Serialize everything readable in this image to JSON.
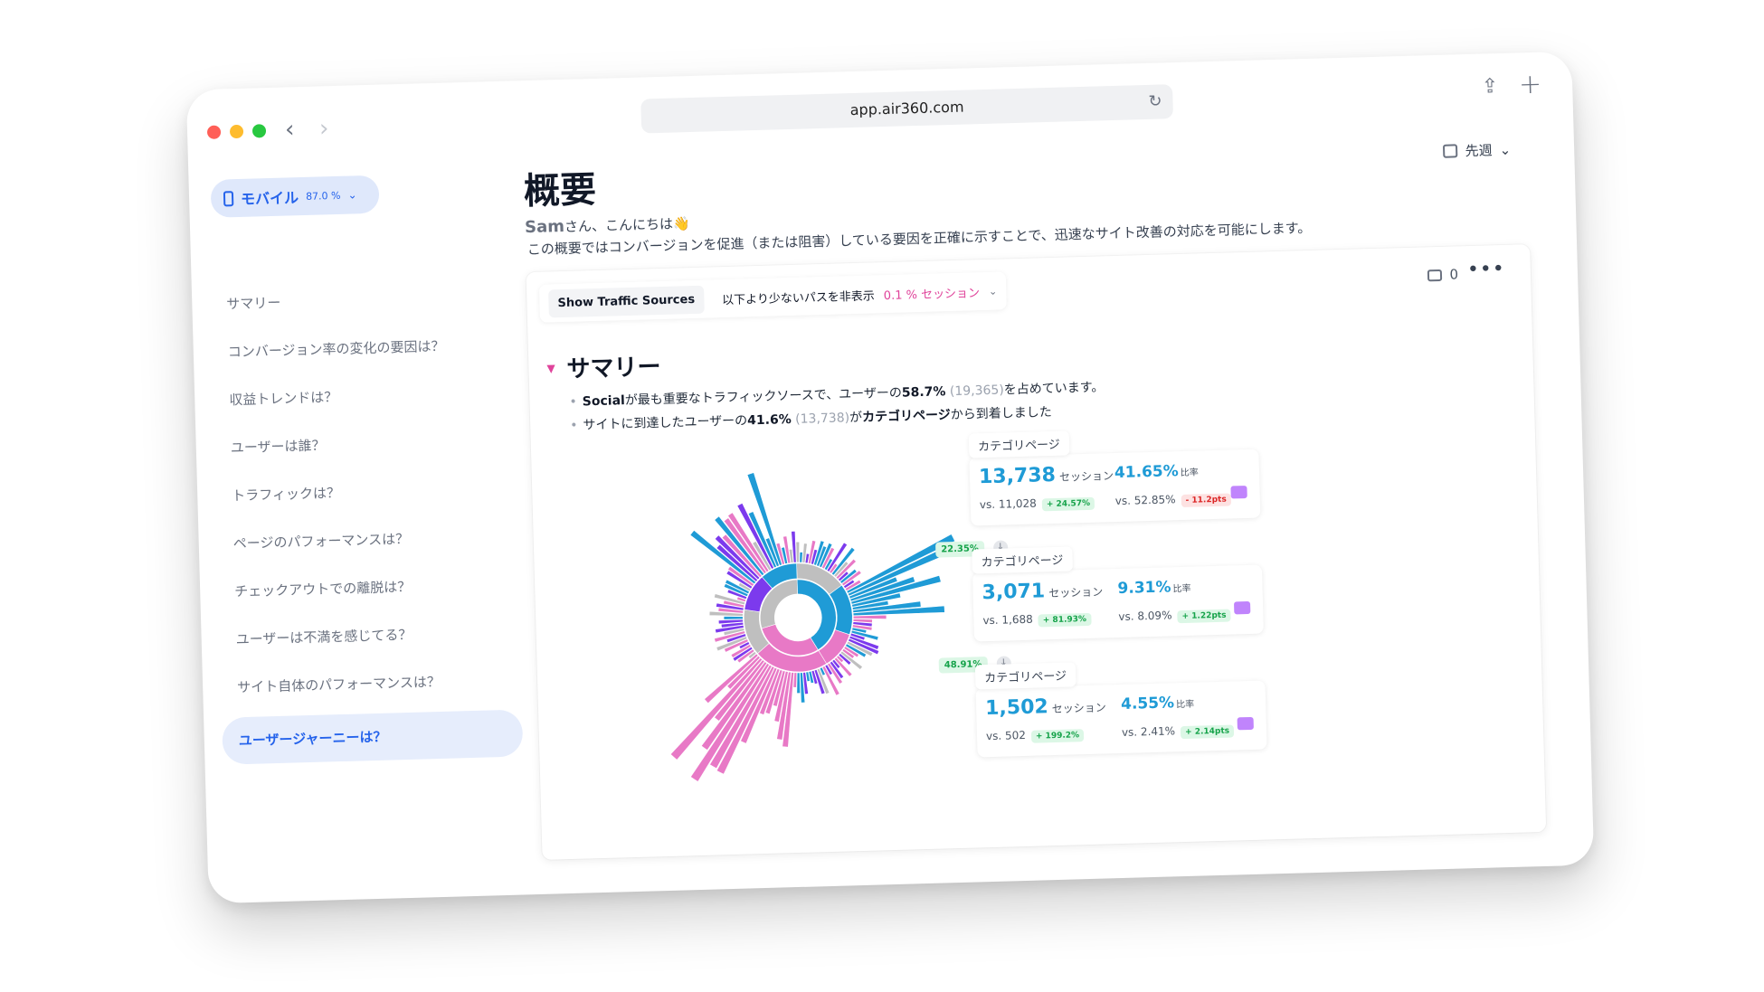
{
  "browser": {
    "url": "app.air360.com"
  },
  "sidebar": {
    "device": {
      "name": "モバイル",
      "percent": "87.0 %"
    },
    "items": [
      {
        "label": "サマリー"
      },
      {
        "label": "コンバージョン率の変化の要因は？"
      },
      {
        "label": "収益トレンドは？"
      },
      {
        "label": "ユーザーは誰？"
      },
      {
        "label": "トラフィックは？"
      },
      {
        "label": "ページのパフォーマンスは？"
      },
      {
        "label": "チェックアウトでの離脱は？"
      },
      {
        "label": "ユーザーは不満を感じてる？"
      },
      {
        "label": "サイト自体のパフォーマンスは？"
      },
      {
        "label": "ユーザージャーニーは？"
      }
    ]
  },
  "header": {
    "title": "概要",
    "period": "先週",
    "user": "Sam",
    "greeting": "さん、こんにちは👋",
    "description": "この概要ではコンバージョンを促進（または阻害）している要因を正確に示すことで、迅速なサイト改善の対応を可能にします。"
  },
  "toolbar": {
    "traffic_button": "Show Traffic Sources",
    "hide_label": "以下より少ないパスを非表示",
    "threshold": "0.1 % セッション",
    "comment_count": "0"
  },
  "summary": {
    "title": "サマリー",
    "b1_src": "Social",
    "b1_mid": "が最も重要なトラフィックソースで、ユーザーの",
    "b1_pct": "58.7%",
    "b1_count": "(19,365)",
    "b1_end": "を占めています。",
    "b2_start": "サイトに到達したユーザーの",
    "b2_pct": "41.6%",
    "b2_count": "(13,738)",
    "b2_mid": "が",
    "b2_page": "カテゴリページ",
    "b2_end": "から到着しました"
  },
  "colors": {
    "blue": "#1f9bd6",
    "pink": "#e879c6",
    "gray": "#bfbfbf",
    "purple": "#7c3aed"
  },
  "funnel": {
    "steps": [
      {
        "label": "カテゴリページ",
        "sessions": "13,738",
        "sessions_unit": "セッション",
        "rate": "41.65%",
        "rate_unit": "比率",
        "vs_sessions": "vs. 11,028",
        "sessions_delta": "+ 24.57%",
        "vs_rate": "vs. 52.85%",
        "rate_delta": "- 11.2pts",
        "rate_delta_type": "red"
      },
      {
        "label": "カテゴリページ",
        "sessions": "3,071",
        "sessions_unit": "セッション",
        "rate": "9.31%",
        "rate_unit": "比率",
        "vs_sessions": "vs. 1,688",
        "sessions_delta": "+ 81.93%",
        "vs_rate": "vs. 8.09%",
        "rate_delta": "+ 1.22pts",
        "rate_delta_type": "green"
      },
      {
        "label": "カテゴリページ",
        "sessions": "1,502",
        "sessions_unit": "セッション",
        "rate": "4.55%",
        "rate_unit": "比率",
        "vs_sessions": "vs. 502",
        "sessions_delta": "+ 199.2%",
        "vs_rate": "vs. 2.41%",
        "rate_delta": "+ 2.14pts",
        "rate_delta_type": "green"
      }
    ],
    "drops": [
      "22.35%",
      "48.91%"
    ]
  }
}
